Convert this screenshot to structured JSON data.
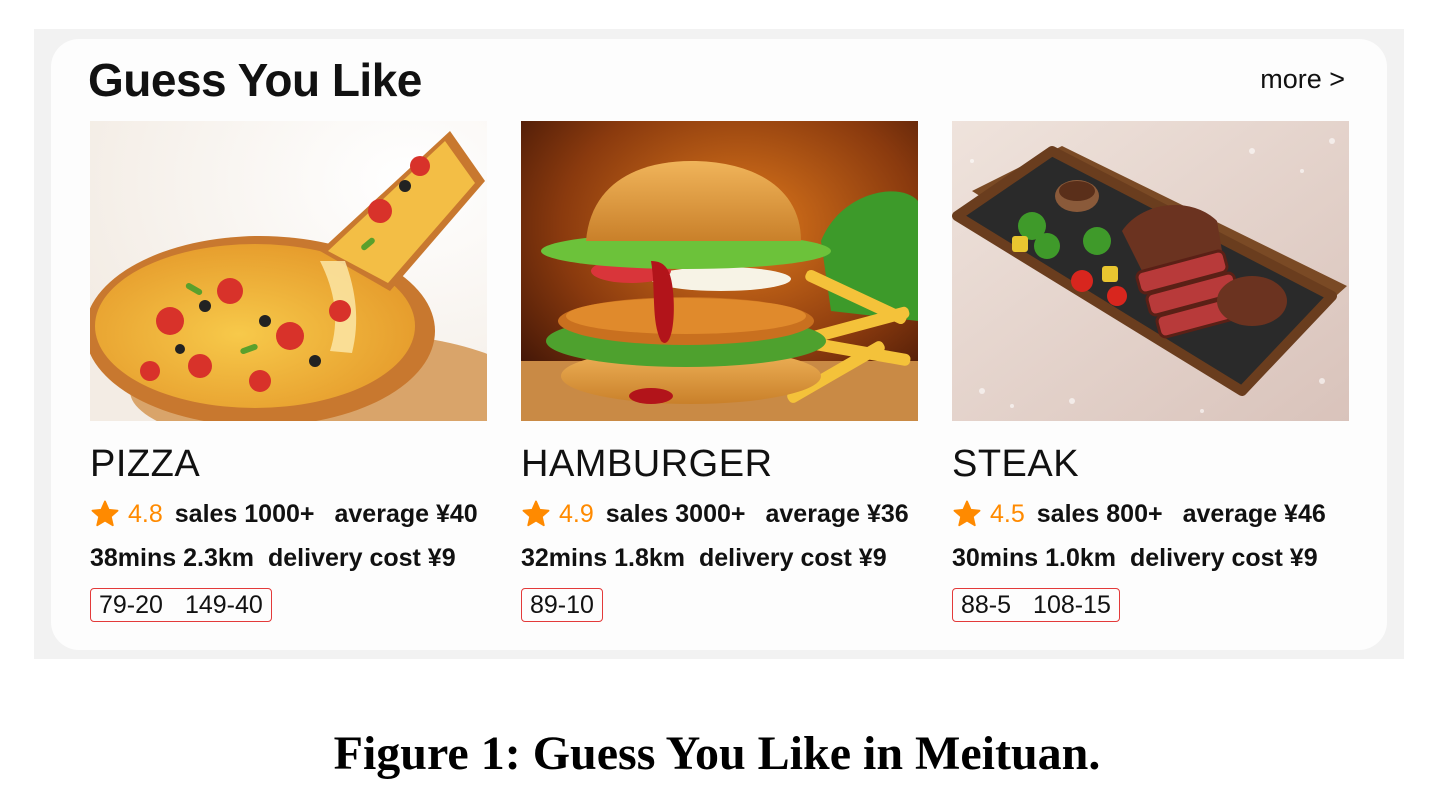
{
  "header": {
    "title": "Guess You Like",
    "more_label": "more >"
  },
  "items": [
    {
      "name": "PIZZA",
      "rating": "4.8",
      "sales": "sales 1000+",
      "average": "average ¥40",
      "time_distance": "38mins 2.3km",
      "delivery_cost": "delivery cost ¥9",
      "coupons": [
        "79-20",
        "149-40"
      ],
      "image": "pizza-photo"
    },
    {
      "name": "HAMBURGER",
      "rating": "4.9",
      "sales": "sales 3000+",
      "average": "average ¥36",
      "time_distance": "32mins 1.8km",
      "delivery_cost": "delivery cost ¥9",
      "coupons": [
        "89-10"
      ],
      "image": "hamburger-photo"
    },
    {
      "name": "STEAK",
      "rating": "4.5",
      "sales": "sales 800+",
      "average": "average ¥46",
      "time_distance": "30mins 1.0km",
      "delivery_cost": "delivery cost ¥9",
      "coupons": [
        "88-5",
        "108-15"
      ],
      "image": "steak-photo"
    }
  ],
  "caption": "Figure 1: Guess You Like in Meituan.",
  "colors": {
    "accent": "#ff8a00",
    "coupon_border": "#e33a3a",
    "panel_bg": "#f2f2f2",
    "card_bg": "#fdfdfd"
  }
}
